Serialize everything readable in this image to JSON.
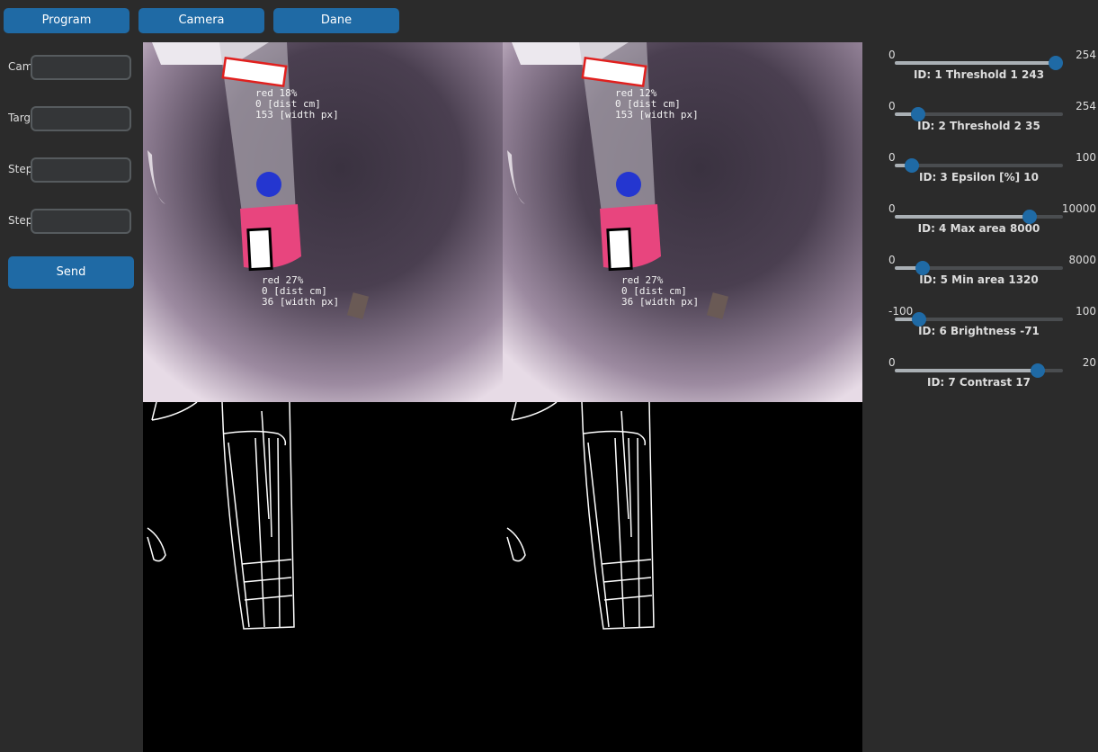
{
  "tabs": [
    {
      "label": "Program"
    },
    {
      "label": "Camera"
    },
    {
      "label": "Dane"
    }
  ],
  "inputs": [
    {
      "label": "Cam",
      "value": "",
      "placeholder": ""
    },
    {
      "label": "Targ",
      "value": "",
      "placeholder": ""
    },
    {
      "label": "Step",
      "value": "",
      "placeholder": ""
    },
    {
      "label": "Step",
      "value": "",
      "placeholder": ""
    }
  ],
  "send_label": "Send",
  "overlays": {
    "left_top": "red 18%\n0 [dist cm]\n153 [width px]",
    "left_bottom": "red 27%\n0 [dist cm]\n36 [width px]",
    "right_top": "red 12%\n0 [dist cm]\n153 [width px]",
    "right_bottom": "red 27%\n0 [dist cm]\n36 [width px]"
  },
  "sliders": [
    {
      "min": "0",
      "max": "254",
      "fraction": 0.957,
      "label": "ID: 1 Threshold 1 243"
    },
    {
      "min": "0",
      "max": "254",
      "fraction": 0.138,
      "label": "ID: 2 Threshold 2 35"
    },
    {
      "min": "0",
      "max": "100",
      "fraction": 0.1,
      "label": "ID: 3 Epsilon [%] 10"
    },
    {
      "min": "0",
      "max": "10000",
      "fraction": 0.8,
      "label": "ID: 4 Max area 8000"
    },
    {
      "min": "0",
      "max": "8000",
      "fraction": 0.165,
      "label": "ID: 5 Min area 1320"
    },
    {
      "min": "-100",
      "max": "100",
      "fraction": 0.145,
      "label": "ID: 6 Brightness -71"
    },
    {
      "min": "0",
      "max": "20",
      "fraction": 0.85,
      "label": "ID: 7 Contrast 17"
    }
  ],
  "colors": {
    "accent": "#1f6aa5",
    "background": "#2b2b2b",
    "marker_pink": "#e8457e",
    "contour_red": "#e0201e"
  }
}
